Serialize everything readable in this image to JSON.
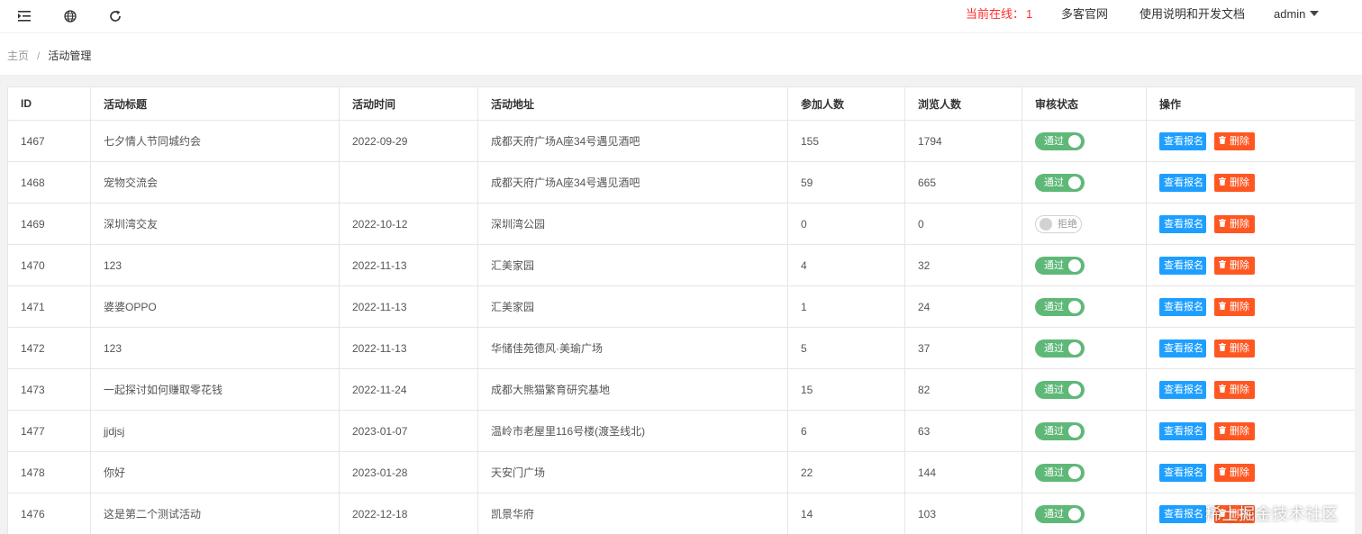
{
  "header": {
    "online_label": "当前在线：",
    "online_count": "1",
    "link_official": "多客官网",
    "link_docs": "使用说明和开发文档",
    "user": "admin",
    "icons": [
      "menu-fold-icon",
      "globe-icon",
      "refresh-icon"
    ]
  },
  "breadcrumb": {
    "home": "主页",
    "separator": "/",
    "current": "活动管理"
  },
  "table": {
    "columns": [
      "ID",
      "活动标题",
      "活动时间",
      "活动地址",
      "参加人数",
      "浏览人数",
      "审核状态",
      "操作"
    ],
    "rows": [
      {
        "id": "1467",
        "title": "七夕情人节同城约会",
        "date": "2022-09-29",
        "address": "成都天府广场A座34号遇见酒吧",
        "joined": "155",
        "views": "1794",
        "status": "通过",
        "approved": true
      },
      {
        "id": "1468",
        "title": "宠物交流会",
        "date": "",
        "address": "成都天府广场A座34号遇见酒吧",
        "joined": "59",
        "views": "665",
        "status": "通过",
        "approved": true
      },
      {
        "id": "1469",
        "title": "深圳湾交友",
        "date": "2022-10-12",
        "address": "深圳湾公园",
        "joined": "0",
        "views": "0",
        "status": "拒绝",
        "approved": false
      },
      {
        "id": "1470",
        "title": "123",
        "date": "2022-11-13",
        "address": "汇美家园",
        "joined": "4",
        "views": "32",
        "status": "通过",
        "approved": true
      },
      {
        "id": "1471",
        "title": "婆婆OPPO",
        "date": "2022-11-13",
        "address": "汇美家园",
        "joined": "1",
        "views": "24",
        "status": "通过",
        "approved": true
      },
      {
        "id": "1472",
        "title": "123",
        "date": "2022-11-13",
        "address": "华储佳苑德风·美瑜广场",
        "joined": "5",
        "views": "37",
        "status": "通过",
        "approved": true
      },
      {
        "id": "1473",
        "title": "一起探讨如何赚取零花钱",
        "date": "2022-11-24",
        "address": "成都大熊猫繁育研究基地",
        "joined": "15",
        "views": "82",
        "status": "通过",
        "approved": true
      },
      {
        "id": "1477",
        "title": "jjdjsj",
        "date": "2023-01-07",
        "address": "温岭市老屋里116号楼(渡圣线北)",
        "joined": "6",
        "views": "63",
        "status": "通过",
        "approved": true
      },
      {
        "id": "1478",
        "title": "你好",
        "date": "2023-01-28",
        "address": "天安门广场",
        "joined": "22",
        "views": "144",
        "status": "通过",
        "approved": true
      },
      {
        "id": "1476",
        "title": "这是第二个测试活动",
        "date": "2022-12-18",
        "address": "凯景华府",
        "joined": "14",
        "views": "103",
        "status": "通过",
        "approved": true
      }
    ],
    "actions": {
      "view_signups": "查看报名",
      "delete": "删除"
    }
  },
  "watermark": "稀土掘金技术社区",
  "colors": {
    "approved": "#5fb878",
    "view_button": "#1e9fff",
    "delete_button": "#ff5722",
    "online": "#ff2b2b"
  }
}
